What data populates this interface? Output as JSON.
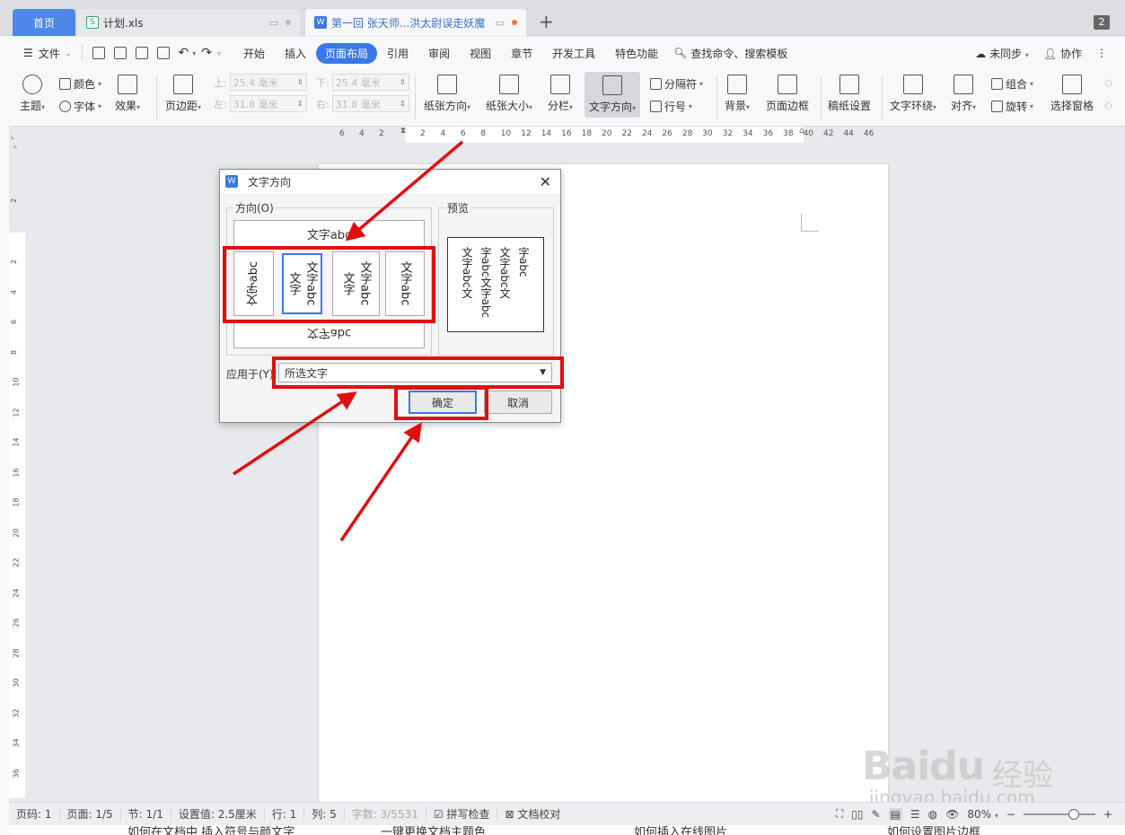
{
  "tabs": [
    {
      "label": "首页"
    },
    {
      "label": "计划.xls",
      "icon": "spreadsheet-icon"
    },
    {
      "label": "第一回 张天师...洪太尉误走妖魔",
      "icon": "word-doc-icon"
    }
  ],
  "tab_count": "2",
  "menu": {
    "file": "文件",
    "items": [
      "开始",
      "插入",
      "页面布局",
      "引用",
      "审阅",
      "视图",
      "章节",
      "开发工具",
      "特色功能"
    ],
    "active": "页面布局",
    "search": "查找命令、搜索模板",
    "sync": "未同步",
    "collab": "协作"
  },
  "ribbon": {
    "theme": "主题",
    "color": "颜色",
    "font": "字体",
    "effect": "效果",
    "margins": "页边距",
    "margin_top_label": "上:",
    "margin_top": "25.4 毫米",
    "margin_bottom_label": "下:",
    "margin_bottom": "25.4 毫米",
    "margin_left_label": "左:",
    "margin_left": "31.8 毫米",
    "margin_right_label": "右:",
    "margin_right": "31.8 毫米",
    "orientation": "纸张方向",
    "size": "纸张大小",
    "columns": "分栏",
    "text_direction": "文字方向",
    "breaks": "分隔符",
    "line_numbers": "行号",
    "background": "背景",
    "page_border": "页面边框",
    "paper_setup": "稿纸设置",
    "wrap": "文字环绕",
    "align": "对齐",
    "group": "组合",
    "rotate": "旋转",
    "selection_pane": "选择窗格"
  },
  "ruler_h": [
    "6",
    "4",
    "2",
    "2",
    "4",
    "6",
    "8",
    "10",
    "12",
    "14",
    "16",
    "18",
    "20",
    "22",
    "24",
    "26",
    "28",
    "30",
    "32",
    "34",
    "36",
    "38",
    "40",
    "42",
    "44",
    "46"
  ],
  "ruler_v": [
    "2",
    "2",
    "4",
    "6",
    "8",
    "10",
    "12",
    "14",
    "16",
    "18",
    "20",
    "22",
    "24",
    "26",
    "28",
    "30",
    "32",
    "34",
    "36"
  ],
  "dialog": {
    "title": "文字方向",
    "direction_label": "方向(O)",
    "preview_label": "预览",
    "option_horizontal": "文字abc",
    "option_rotated": "文字abc",
    "option_vertical_1": "文字abc",
    "option_vertical_2a": "文字",
    "option_vertical_2b": "文字abc",
    "option_vertical_3a": "文字",
    "option_vertical_3b": "文字abc",
    "option_vertical_4": "文字abc",
    "option_upside": "文字abc",
    "preview_col1": "字abc",
    "preview_col2": "文字abc文",
    "preview_col3": "字abc文字abc",
    "preview_col4": "文字abc文",
    "apply_label": "应用于(Y):",
    "apply_value": "所选文字",
    "ok": "确定",
    "cancel": "取消"
  },
  "status": {
    "page_code": "页码: 1",
    "pages": "页面: 1/5",
    "section": "节: 1/1",
    "setting": "设置值: 2.5厘米",
    "row": "行: 1",
    "col": "列: 5",
    "word_count": "字数: 3/5531",
    "spell": "拼写检查",
    "proof": "文档校对",
    "zoom": "80%"
  },
  "bottom_links": [
    "如何在文档中 插入符号与颜文字",
    "一键更换文档主题色",
    "如何插入在线图片",
    "如何设置图片边框"
  ],
  "watermark": {
    "logo": "Baidu",
    "brand": "经验",
    "url": "jingyan.baidu.com"
  },
  "colors": {
    "accent": "#3b78e7",
    "highlight": "#e01010"
  }
}
